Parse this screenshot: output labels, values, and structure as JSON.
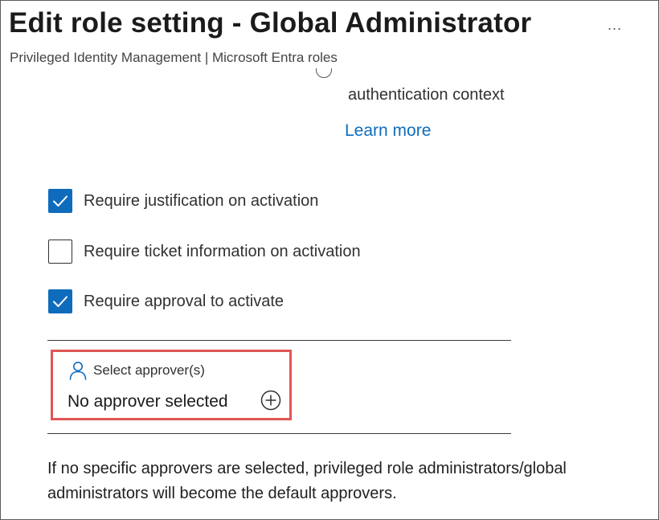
{
  "header": {
    "title": "Edit role setting - Global Administrator",
    "subtitle": "Privileged Identity Management | Microsoft Entra roles",
    "more_label": "..."
  },
  "authentication": {
    "context_label": "authentication context",
    "learn_more": "Learn more"
  },
  "settings": [
    {
      "label": "Require justification on activation",
      "checked": true
    },
    {
      "label": "Require ticket information on activation",
      "checked": false
    },
    {
      "label": "Require approval to activate",
      "checked": true
    }
  ],
  "approvers": {
    "select_label": "Select approver(s)",
    "none_selected": "No approver selected"
  },
  "info": {
    "default_approvers_note": "If no specific approvers are selected, privileged role administrators/global administrators will become the default approvers."
  },
  "colors": {
    "accent": "#0f6cbd",
    "highlight_border": "#e05555"
  },
  "icons": {
    "more": "more-horizontal-icon",
    "person": "person-icon",
    "add": "add-circle-icon",
    "check": "checkmark-icon"
  }
}
